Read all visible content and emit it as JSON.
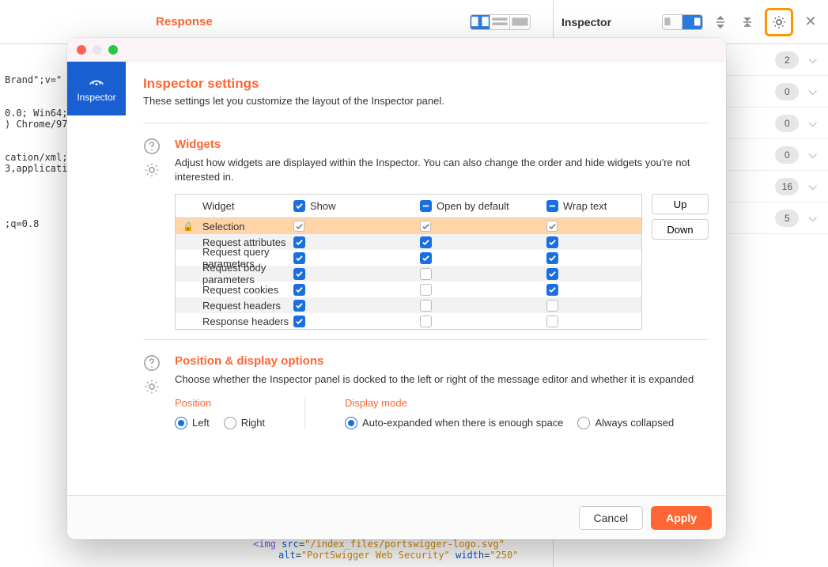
{
  "header": {
    "response": "Response",
    "inspector": "Inspector"
  },
  "sideRows": [
    {
      "count": "2"
    },
    {
      "count": "0"
    },
    {
      "count": "0"
    },
    {
      "count": "0"
    },
    {
      "count": "16"
    },
    {
      "count": "5"
    }
  ],
  "bg_code": "\n\nBrand\";v=\"\n\n\n0.0; Win64;\n) Chrome/97\n\n\ncation/xml;\n3,applicati\n\n\n\n\n;q=0.8",
  "footer_code": {
    "line1_pre": "<img ",
    "line1_attr1": "src",
    "line1_val1": "\"/index_files/portswigger-logo.svg\"",
    "line2_attr1": "alt",
    "line2_val1": "\"PortSwigger Web Security\"",
    "line2_attr2": "width",
    "line2_val2": "\"250\""
  },
  "modal": {
    "sidebar_tab": "Inspector",
    "title": "Inspector settings",
    "subtitle": "These settings let you customize the layout of the Inspector panel.",
    "widgets": {
      "heading": "Widgets",
      "desc": "Adjust how widgets are displayed within the Inspector. You can also change the order and hide widgets you're not interested in.",
      "cols": {
        "name": "Widget",
        "show": "Show",
        "open": "Open by default",
        "wrap": "Wrap text"
      },
      "rows": [
        {
          "name": "Selection",
          "show": true,
          "open": true,
          "wrap": true,
          "selected": true,
          "locked": true
        },
        {
          "name": "Request attributes",
          "show": true,
          "open": true,
          "wrap": true
        },
        {
          "name": "Request query parameters",
          "show": true,
          "open": true,
          "wrap": true
        },
        {
          "name": "Request body parameters",
          "show": true,
          "open": false,
          "wrap": true
        },
        {
          "name": "Request cookies",
          "show": true,
          "open": false,
          "wrap": true
        },
        {
          "name": "Request headers",
          "show": true,
          "open": false,
          "wrap": false
        },
        {
          "name": "Response headers",
          "show": true,
          "open": false,
          "wrap": false
        }
      ],
      "up": "Up",
      "down": "Down"
    },
    "position": {
      "heading": "Position & display options",
      "desc": "Choose whether the Inspector panel is docked to the left or right of the message editor and whether it is expanded",
      "position_label": "Position",
      "display_label": "Display mode",
      "left": "Left",
      "right": "Right",
      "auto": "Auto-expanded when there is enough space",
      "collapsed": "Always collapsed"
    },
    "cancel": "Cancel",
    "apply": "Apply"
  }
}
